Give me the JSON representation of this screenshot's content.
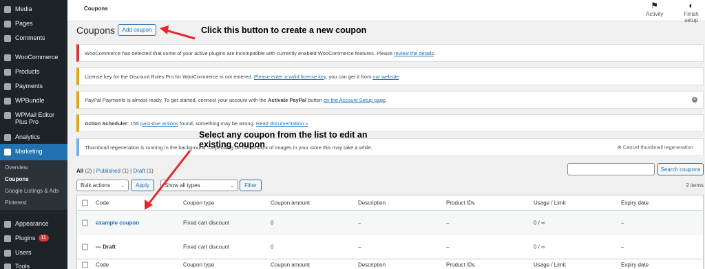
{
  "sidebar": {
    "items": [
      {
        "label": "Media",
        "icon": "media-icon"
      },
      {
        "label": "Pages",
        "icon": "pages-icon"
      },
      {
        "label": "Comments",
        "icon": "comments-icon"
      },
      {
        "label": "WooCommerce",
        "icon": "woocommerce-icon"
      },
      {
        "label": "Products",
        "icon": "products-icon"
      },
      {
        "label": "Payments",
        "icon": "payments-icon"
      },
      {
        "label": "WPBundle",
        "icon": "wpbundle-icon"
      },
      {
        "label": "WPMail Editor Plus Pro",
        "icon": "wpmail-icon"
      },
      {
        "label": "Analytics",
        "icon": "analytics-icon"
      },
      {
        "label": "Marketing",
        "icon": "marketing-icon"
      },
      {
        "label": "Appearance",
        "icon": "appearance-icon"
      },
      {
        "label": "Plugins",
        "icon": "plugins-icon",
        "badge": "11"
      },
      {
        "label": "Users",
        "icon": "users-icon"
      },
      {
        "label": "Tools",
        "icon": "tools-icon"
      }
    ],
    "submenu": [
      {
        "label": "Overview"
      },
      {
        "label": "Coupons"
      },
      {
        "label": "Google Listings & Ads"
      },
      {
        "label": "Pinterest"
      }
    ]
  },
  "topbar": {
    "breadcrumb": "Coupons",
    "activity_label": "Activity",
    "finish_setup_label": "Finish setup"
  },
  "page": {
    "title": "Coupons",
    "add_coupon_label": "Add coupon"
  },
  "notices": {
    "n1_text": "WooCommerce has detected that some of your active plugins are incompatible with currently enabled WooCommerce features. Please ",
    "n1_link": "review the details",
    "n1_end": ".",
    "n2_text": "License key for the Discount Rules Pro for WooCommerce is not entered. ",
    "n2_link": "Please enter a valid license key",
    "n2_mid": ", you can get it from ",
    "n2_link2": "our website",
    "n3_text": "PayPal Payments is almost ready. To get started, connect your account with the ",
    "n3_bold": "Activate PayPal",
    "n3_mid": " button ",
    "n3_link": "on the Account Setup page",
    "n3_end": ".",
    "n4_bold": "Action Scheduler:",
    "n4_text": " 155 ",
    "n4_link": "past-due actions",
    "n4_mid": " found; something may be wrong. ",
    "n4_link2": "Read documentation »",
    "n5_text": "Thumbnail regeneration is running in the background. Depending on the amount of images in your store this may take a while.",
    "n5_cancel": "Cancel thumbnail regeneration"
  },
  "filters": {
    "all_label": "All",
    "all_count": "(2)",
    "sep1": " | ",
    "published_label": "Published",
    "published_count": "(1)",
    "sep2": " | ",
    "draft_label": "Draft",
    "draft_count": "(1)",
    "bulk_actions": "Bulk actions",
    "apply_label": "Apply",
    "show_all_types": "Show all types",
    "filter_label": "Filter",
    "search_value": "",
    "search_button": "Search coupons",
    "items_count": "2 items"
  },
  "table": {
    "columns": [
      "Code",
      "Coupon type",
      "Coupon amount",
      "Description",
      "Product IDs",
      "Usage / Limit",
      "Expiry date"
    ],
    "rows": [
      {
        "code": "example coupon",
        "type": "Fixed cart discount",
        "amount": "0",
        "description": "–",
        "product_ids": "–",
        "usage": "0 / ∞",
        "expiry": "–"
      },
      {
        "code": "— Draft",
        "type": "Fixed cart discount",
        "amount": "0",
        "description": "–",
        "product_ids": "–",
        "usage": "0 / ∞",
        "expiry": "–"
      }
    ]
  },
  "annotations": {
    "add_button_note": "Click this button to create a new coupon",
    "select_note_line1": "Select any coupon from the list to edit an",
    "select_note_line2": "existing coupon",
    "arrow_color": "#e8262a"
  }
}
